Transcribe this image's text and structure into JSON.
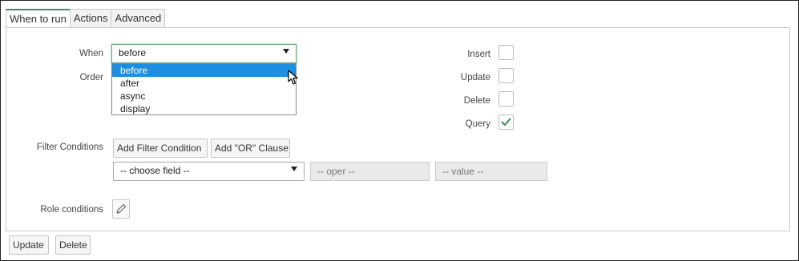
{
  "tabs": [
    "When to run",
    "Actions",
    "Advanced"
  ],
  "when": {
    "label": "When",
    "value": "before",
    "options": [
      "before",
      "after",
      "async",
      "display"
    ]
  },
  "order": {
    "label": "Order"
  },
  "operations": [
    {
      "label": "Insert",
      "checked": false
    },
    {
      "label": "Update",
      "checked": false
    },
    {
      "label": "Delete",
      "checked": false
    },
    {
      "label": "Query",
      "checked": true
    }
  ],
  "filter": {
    "label": "Filter Conditions",
    "add_filter": "Add Filter Condition",
    "add_or": "Add \"OR\" Clause",
    "field": "-- choose field --",
    "oper": "-- oper --",
    "value": "-- value --"
  },
  "role": {
    "label": "Role conditions"
  },
  "footer": {
    "update": "Update",
    "delete": "Delete"
  },
  "colors": {
    "accent": "#3d8f59",
    "selection": "#1e8fe0",
    "check": "#3a8a5c"
  }
}
